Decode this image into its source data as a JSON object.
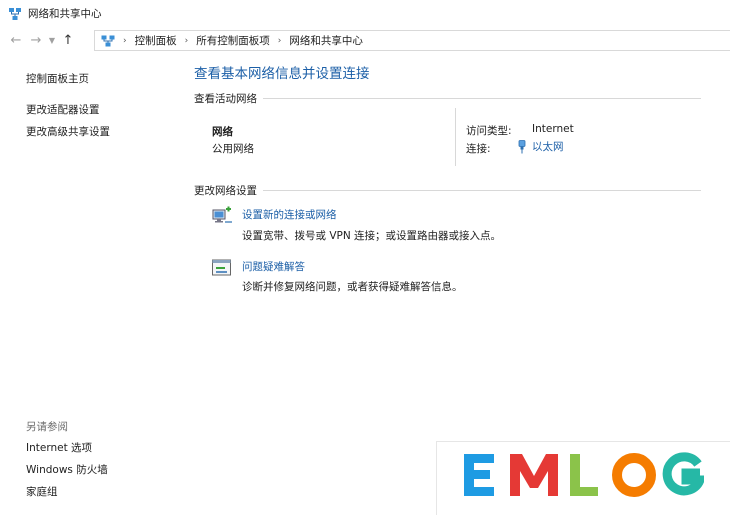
{
  "window": {
    "title": "网络和共享中心"
  },
  "breadcrumbs": [
    "控制面板",
    "所有控制面板项",
    "网络和共享中心"
  ],
  "sidebar": {
    "links": [
      "控制面板主页",
      "更改适配器设置",
      "更改高级共享设置"
    ],
    "see_also_label": "另请参阅",
    "see_also": [
      "Internet 选项",
      "Windows 防火墙",
      "家庭组"
    ]
  },
  "main": {
    "title": "查看基本网络信息并设置连接",
    "active_section": "查看活动网络",
    "network": {
      "name": "网络",
      "type": "公用网络",
      "access_label": "访问类型:",
      "access_value": "Internet",
      "connection_label": "连接:",
      "connection_value": "以太网"
    },
    "change_section": "更改网络设置",
    "tasks": [
      {
        "link": "设置新的连接或网络",
        "desc": "设置宽带、拨号或 VPN 连接；或设置路由器或接入点。",
        "icon": "new-connection-icon"
      },
      {
        "link": "问题疑难解答",
        "desc": "诊断并修复网络问题，或者获得疑难解答信息。",
        "icon": "troubleshoot-icon"
      }
    ]
  },
  "watermark": {
    "text": "EMLOG",
    "colors": [
      "#1e9be3",
      "#e53935",
      "#8bc34a",
      "#f57c00",
      "#26b8a6"
    ]
  },
  "colors": {
    "link": "#1c5fa7",
    "text": "#1e1e1e",
    "muted": "#6d6d6d"
  }
}
